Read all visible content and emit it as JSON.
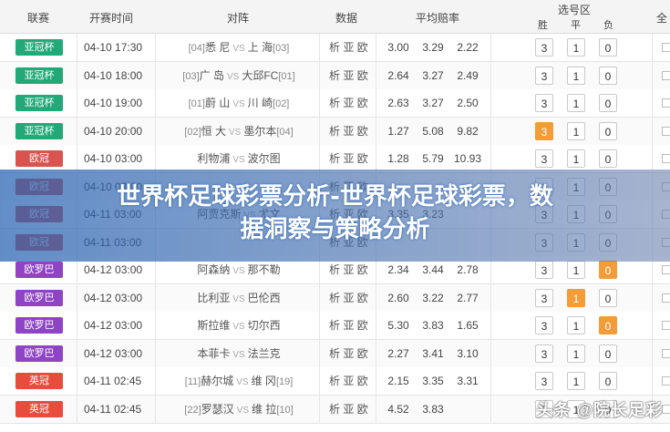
{
  "header": {
    "league": "联赛",
    "time": "开赛时间",
    "match": "对阵",
    "data": "数据",
    "avg_odds": "平均赔率",
    "pick_area": "选号区",
    "win": "胜",
    "draw": "平",
    "lose": "负",
    "all_prefix": "全"
  },
  "banner": {
    "line1": "世界杯足球彩票分析-世界杯足球彩票，数",
    "line2": "据洞察与策略分析"
  },
  "watermark": "头条 @院长足彩",
  "data_links": [
    "析",
    "亚",
    "欧"
  ],
  "rows": [
    {
      "league": "亚冠杯",
      "color": "#22a978",
      "time": "04-10 17:30",
      "home_rank": "[04]",
      "home": "悉 尼",
      "away": "上 海",
      "away_rank": "[03]",
      "o1": "3.00",
      "o2": "3.29",
      "o3": "2.22",
      "p1": "3",
      "p2": "1",
      "p3": "0",
      "on": ""
    },
    {
      "league": "亚冠杯",
      "color": "#22a978",
      "time": "04-10 18:00",
      "home_rank": "[03]",
      "home": "广 岛",
      "away": "大邱FC",
      "away_rank": "[01]",
      "o1": "2.64",
      "o2": "3.27",
      "o3": "2.49",
      "p1": "3",
      "p2": "1",
      "p3": "0",
      "on": ""
    },
    {
      "league": "亚冠杯",
      "color": "#22a978",
      "time": "04-10 19:00",
      "home_rank": "[01]",
      "home": "蔚 山",
      "away": "川 崎",
      "away_rank": "[02]",
      "o1": "2.63",
      "o2": "3.27",
      "o3": "2.50",
      "p1": "3",
      "p2": "1",
      "p3": "0",
      "on": ""
    },
    {
      "league": "亚冠杯",
      "color": "#22a978",
      "time": "04-10 20:00",
      "home_rank": "[02]",
      "home": "恒 大",
      "away": "墨尔本",
      "away_rank": "[04]",
      "o1": "1.27",
      "o2": "5.08",
      "o3": "9.82",
      "p1": "3",
      "p2": "1",
      "p3": "0",
      "on": "p1"
    },
    {
      "league": "欧冠",
      "color": "#d9534f",
      "time": "04-10 03:00",
      "home_rank": "",
      "home": "利物浦",
      "away": "波尔图",
      "away_rank": "",
      "o1": "1.28",
      "o2": "5.79",
      "o3": "10.93",
      "p1": "3",
      "p2": "1",
      "p3": "0",
      "on": ""
    },
    {
      "league": "欧冠",
      "color": "#d9534f",
      "time": "04-10 03:00",
      "home_rank": "",
      "home": "",
      "away": "",
      "away_rank": "",
      "o1": "",
      "o2": "",
      "o3": "",
      "p1": "3",
      "p2": "1",
      "p3": "0",
      "on": ""
    },
    {
      "league": "欧冠",
      "color": "#d9534f",
      "time": "04-11 03:00",
      "home_rank": "",
      "home": "阿贾克斯",
      "away": "尤文",
      "away_rank": "",
      "o1": "3.35",
      "o2": "3.23",
      "o3": "",
      "p1": "3",
      "p2": "1",
      "p3": "0",
      "on": ""
    },
    {
      "league": "欧冠",
      "color": "#d9534f",
      "time": "04-11 03:00",
      "home_rank": "",
      "home": "",
      "away": "",
      "away_rank": "",
      "o1": "",
      "o2": "",
      "o3": "",
      "p1": "3",
      "p2": "1",
      "p3": "0",
      "on": ""
    },
    {
      "league": "欧罗巴",
      "color": "#8e44c5",
      "time": "04-12 03:00",
      "home_rank": "",
      "home": "阿森纳",
      "away": "那不勒",
      "away_rank": "",
      "o1": "2.34",
      "o2": "3.44",
      "o3": "2.78",
      "p1": "3",
      "p2": "1",
      "p3": "0",
      "on": "p3"
    },
    {
      "league": "欧罗巴",
      "color": "#8e44c5",
      "time": "04-12 03:00",
      "home_rank": "",
      "home": "比利亚",
      "away": "巴伦西",
      "away_rank": "",
      "o1": "2.60",
      "o2": "3.22",
      "o3": "2.77",
      "p1": "3",
      "p2": "1",
      "p3": "0",
      "on": "p2"
    },
    {
      "league": "欧罗巴",
      "color": "#8e44c5",
      "time": "04-12 03:00",
      "home_rank": "",
      "home": "斯拉维",
      "away": "切尔西",
      "away_rank": "",
      "o1": "5.30",
      "o2": "3.83",
      "o3": "1.65",
      "p1": "3",
      "p2": "1",
      "p3": "0",
      "on": "p3"
    },
    {
      "league": "欧罗巴",
      "color": "#8e44c5",
      "time": "04-12 03:00",
      "home_rank": "",
      "home": "本菲卡",
      "away": "法兰克",
      "away_rank": "",
      "o1": "2.27",
      "o2": "3.41",
      "o3": "3.10",
      "p1": "3",
      "p2": "1",
      "p3": "0",
      "on": ""
    },
    {
      "league": "英冠",
      "color": "#e74c3c",
      "time": "04-11 02:45",
      "home_rank": "[11]",
      "home": "赫尔城",
      "away": "维 冈",
      "away_rank": "[19]",
      "o1": "2.15",
      "o2": "3.35",
      "o3": "3.31",
      "p1": "3",
      "p2": "1",
      "p3": "0",
      "on": ""
    },
    {
      "league": "英冠",
      "color": "#e74c3c",
      "time": "04-11 02:45",
      "home_rank": "[22]",
      "home": "罗瑟汉",
      "away": "维 拉",
      "away_rank": "[10]",
      "o1": "4.52",
      "o2": "3.83",
      "o3": "",
      "p1": "3",
      "p2": "1",
      "p3": "0",
      "on": ""
    }
  ]
}
